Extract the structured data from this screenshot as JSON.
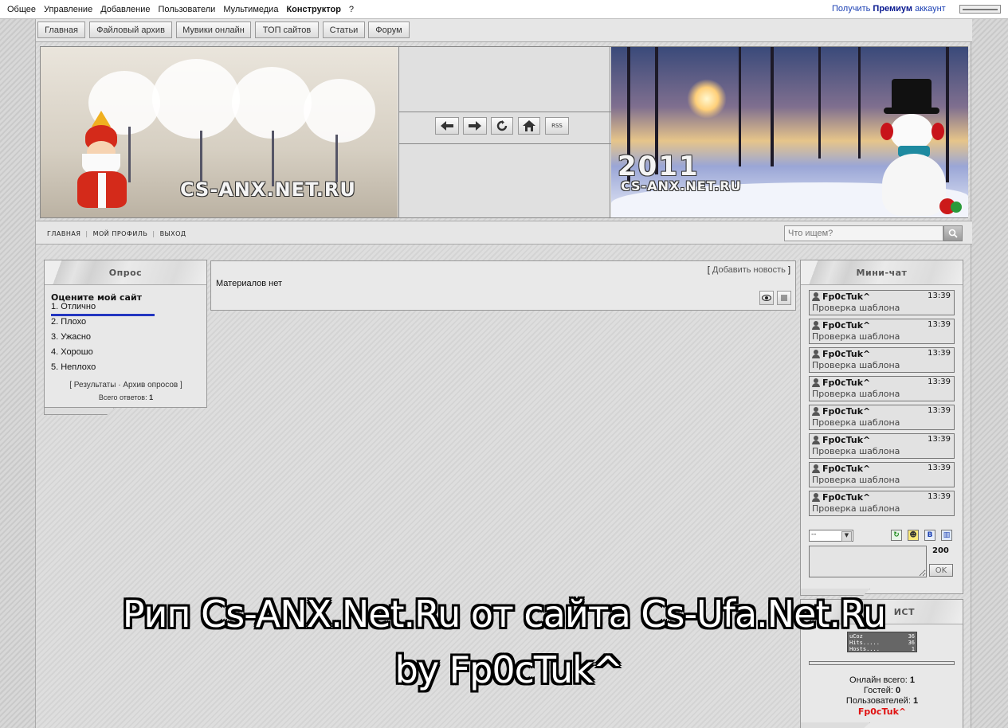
{
  "topbar": {
    "menu": [
      "Общее",
      "Управление",
      "Добавление",
      "Пользователи",
      "Мультимедиа",
      "Конструктор",
      "?"
    ],
    "premium_prefix": "Получить",
    "premium_bold": "Премиум",
    "premium_suffix": "аккаунт"
  },
  "nav": {
    "items": [
      "Главная",
      "Файловый архив",
      "Мувики онлайн",
      "ТОП сайтов",
      "Статьи",
      "Форум"
    ]
  },
  "header": {
    "left_banner_text": "CS-ANX.NET.RU",
    "right_banner_year": "2011",
    "right_banner_text": "CS-ANX.NET.RU",
    "rss_label": "RSS"
  },
  "subnav": {
    "links": [
      "ГЛАВНАЯ",
      "МОЙ ПРОФИЛЬ",
      "ВЫХОД"
    ],
    "search_placeholder": "Что ищем?"
  },
  "poll": {
    "title": "Опрос",
    "question": "Оцените мой сайт",
    "answers": [
      "1. Отлично",
      "2. Плохо",
      "3. Ужасно",
      "4. Хорошо",
      "5. Неплохо"
    ],
    "results_link": "Результаты",
    "archive_link": "Архив опросов",
    "total_label": "Всего ответов:",
    "total_value": "1",
    "top_answer_share": 1.0
  },
  "content": {
    "add_news": "Добавить новость",
    "empty_text": "Материалов нет"
  },
  "chat": {
    "title": "Мини-чат",
    "messages": [
      {
        "user": "Fp0cTuk^",
        "time": "13:39",
        "text": "Проверка шаблона"
      },
      {
        "user": "Fp0cTuk^",
        "time": "13:39",
        "text": "Проверка шаблона"
      },
      {
        "user": "Fp0cTuk^",
        "time": "13:39",
        "text": "Проверка шаблона"
      },
      {
        "user": "Fp0cTuk^",
        "time": "13:39",
        "text": "Проверка шаблона"
      },
      {
        "user": "Fp0cTuk^",
        "time": "13:39",
        "text": "Проверка шаблона"
      },
      {
        "user": "Fp0cTuk^",
        "time": "13:39",
        "text": "Проверка шаблона"
      },
      {
        "user": "Fp0cTuk^",
        "time": "13:39",
        "text": "Проверка шаблона"
      },
      {
        "user": "Fp0cTuk^",
        "time": "13:39",
        "text": "Проверка шаблона"
      }
    ],
    "select_value": "--",
    "char_limit": "200",
    "ok_label": "OK",
    "bb_label": "B"
  },
  "stats": {
    "title_fragment": "ИСТ",
    "counter_rows": [
      {
        "label": "uCoz",
        "value": "36"
      },
      {
        "label": "Hits.....",
        "value": "36"
      },
      {
        "label": "Hosts....",
        "value": "1"
      }
    ],
    "online_total_label": "Онлайн всего:",
    "online_total_value": "1",
    "guests_label": "Гостей:",
    "guests_value": "0",
    "users_label": "Пользователей:",
    "users_value": "1",
    "online_user": "Fp0cTuk^"
  },
  "overlay": {
    "line1": "Рип Cs-ANX.Net.Ru от сайта Cs-Ufa.Net.Ru",
    "line2": "by Fp0cTuk^"
  },
  "colors": {
    "poll_bar": "#2336c0",
    "premium_link": "#1a3fb3",
    "online_user": "#e01010"
  }
}
